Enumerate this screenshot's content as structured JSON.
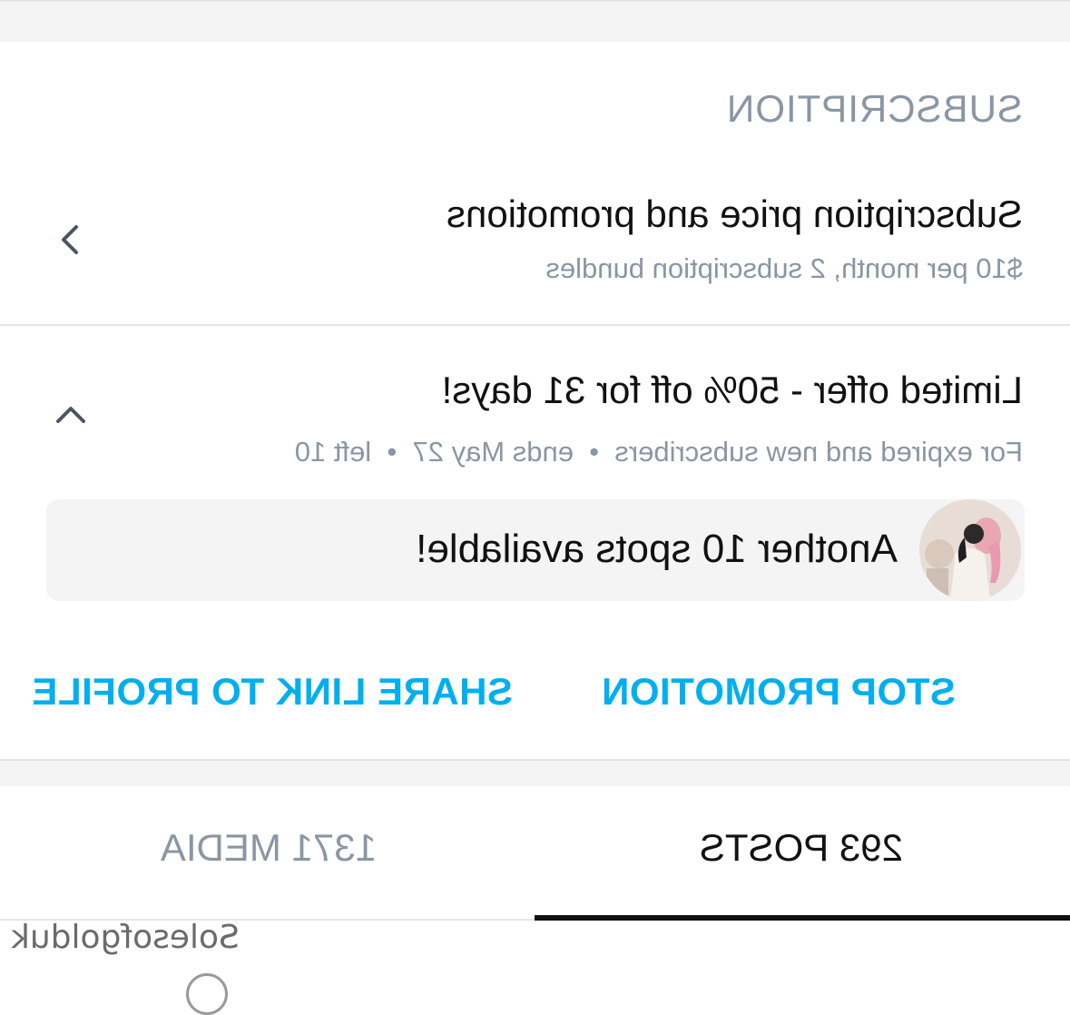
{
  "section": {
    "title": "SUBSCRIPTION"
  },
  "subscription_row": {
    "title": "Subscription price and promotions",
    "subtitle": "$10 per month, 2 subscription bundles"
  },
  "offer_row": {
    "title": "Limited offer - 50% off for 31 days!",
    "subtitle": "For expired and new subscribers  •  ends May 27  •  left 10",
    "message": "Another 10 spots available!"
  },
  "actions": {
    "stop": "STOP PROMOTION",
    "share": "SHARE LINK TO PROFILE"
  },
  "tabs": [
    {
      "label": "293 POSTS",
      "active": true
    },
    {
      "label": "1371 MEDIA",
      "active": false
    }
  ],
  "watermark": "Solesofgolduk",
  "colors": {
    "accent": "#00aff0",
    "muted": "#8a96a3",
    "text": "#111111"
  },
  "icons": {
    "collapse": "chevron-right-icon",
    "expand": "chevron-up-icon"
  }
}
